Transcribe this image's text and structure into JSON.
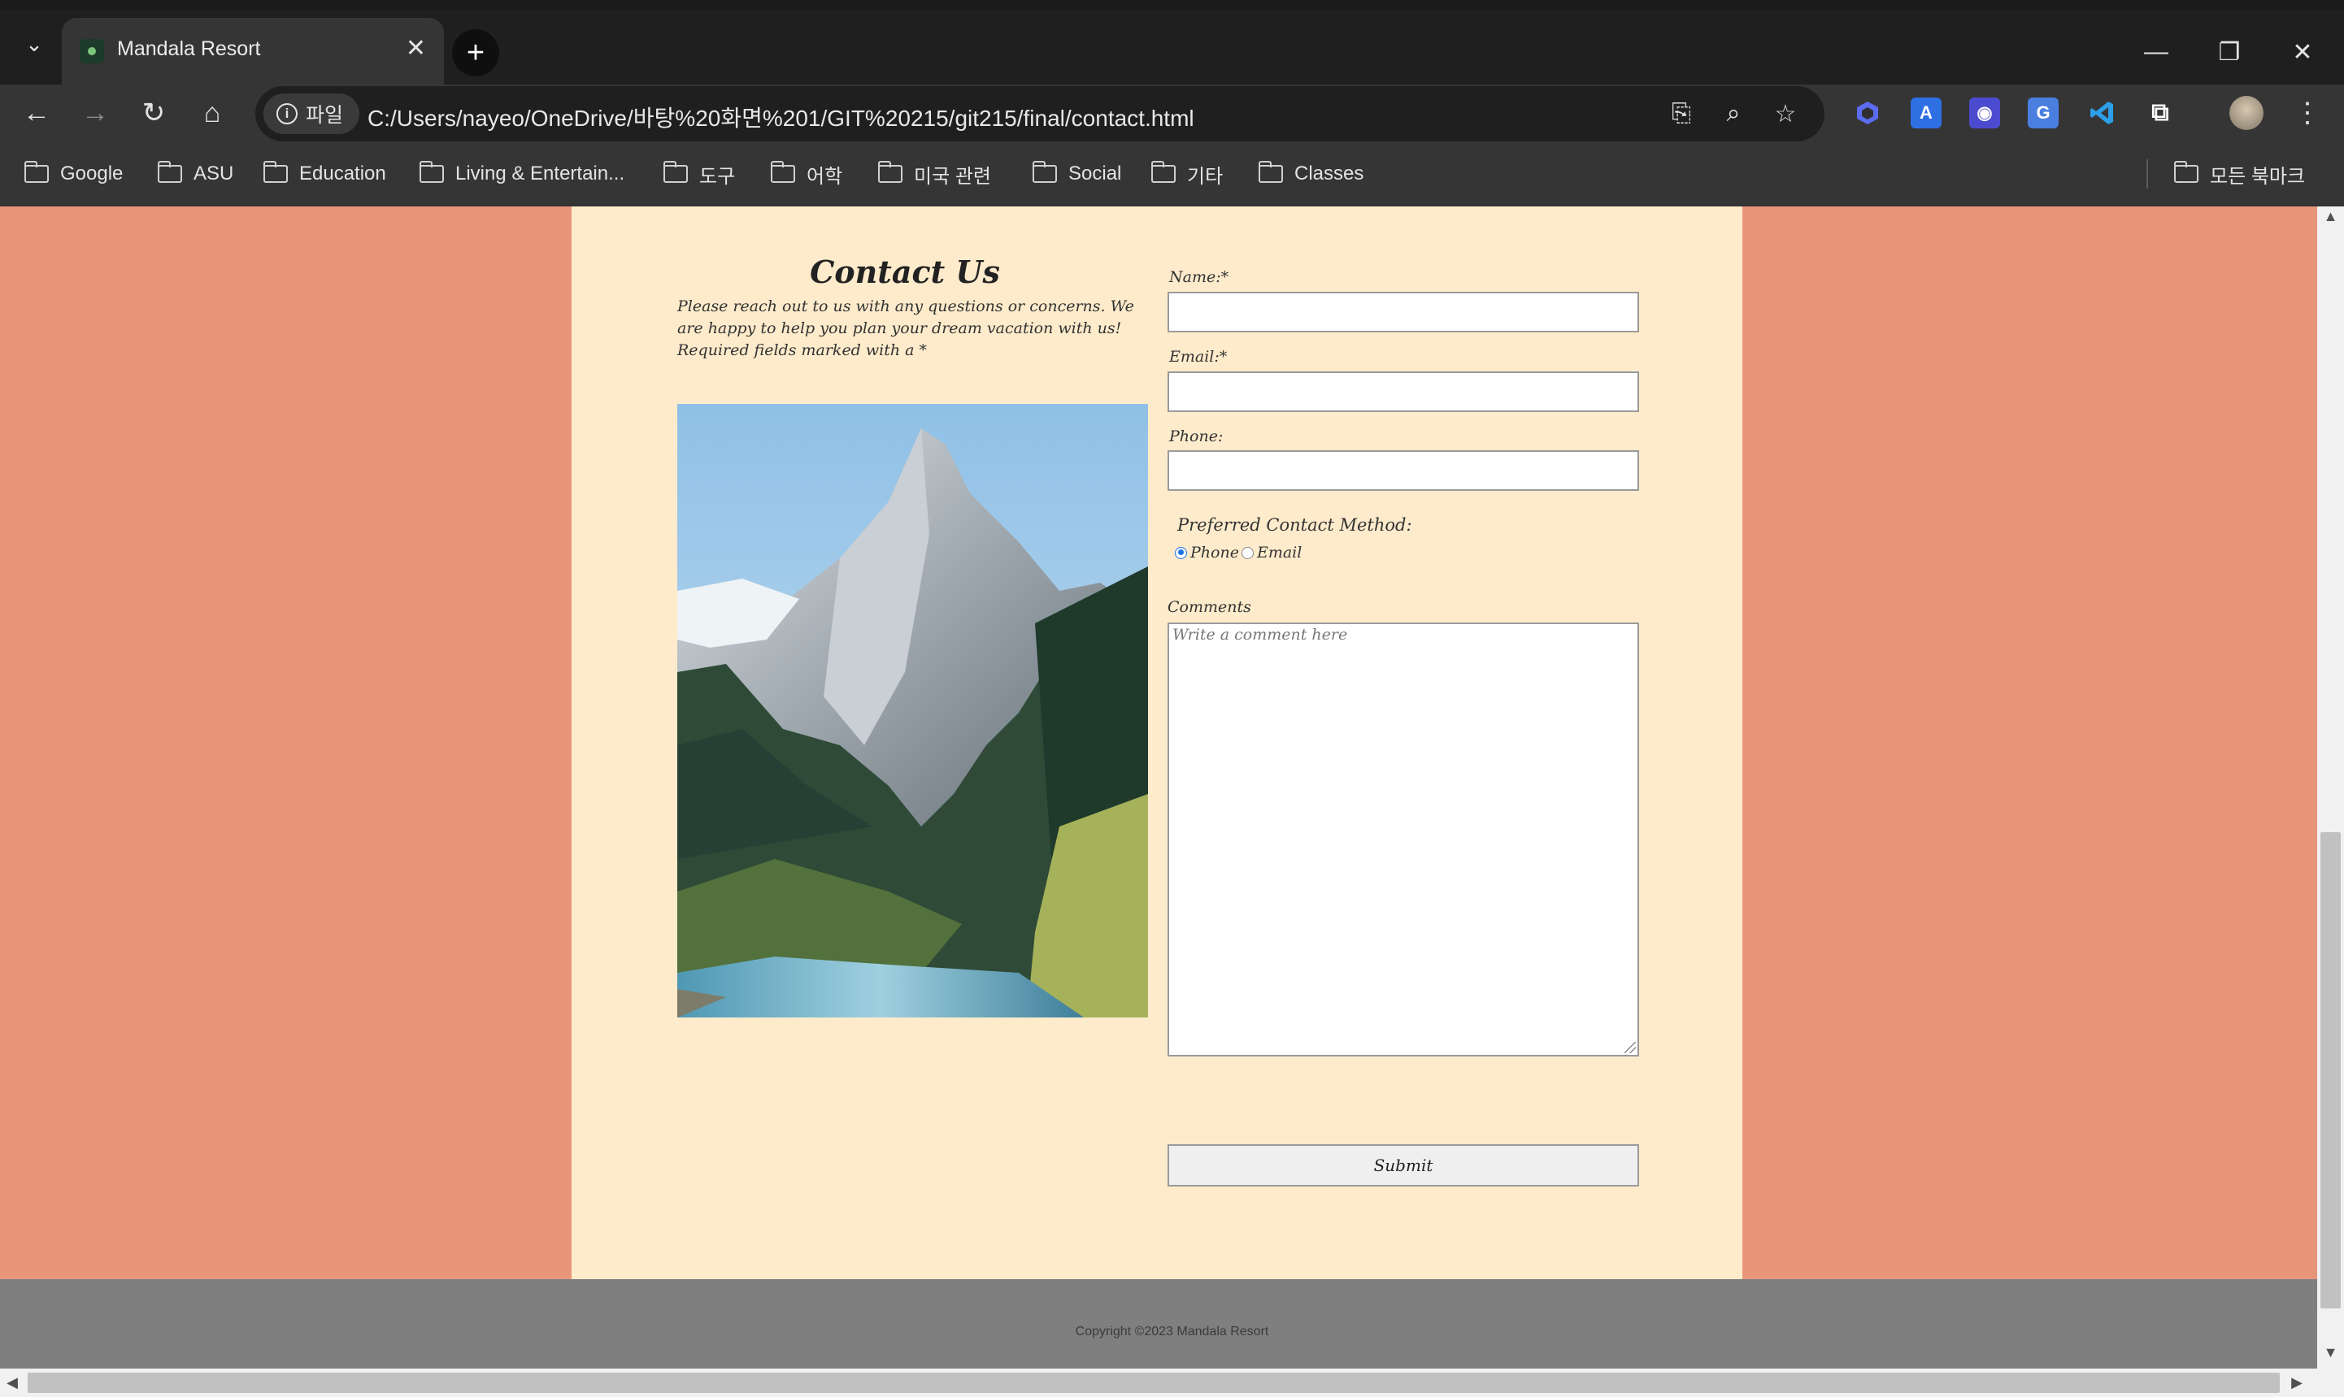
{
  "browser": {
    "tab_title": "Mandala Resort",
    "site_chip": "파일",
    "url": "C:/Users/nayeo/OneDrive/바탕%20화면%201/GIT%20215/git215/final/contact.html",
    "bookmarks": [
      "Google",
      "ASU",
      "Education",
      "Living & Entertain...",
      "도구",
      "어학",
      "미국 관련",
      "Social",
      "기타",
      "Classes"
    ],
    "all_bookmarks": "모든 북마크",
    "extension_letter": "A"
  },
  "page": {
    "heading": "Contact Us",
    "intro": "Please reach out to us with any questions or concerns. We are happy to help you plan your dream vacation with us! Required fields marked with a *",
    "form": {
      "name_label": "Name:*",
      "email_label": "Email:*",
      "phone_label": "Phone:",
      "preferred_label": "Preferred Contact Method:",
      "radio_phone": "Phone",
      "radio_email": "Email",
      "selected_method": "Phone",
      "comments_label": "Comments",
      "comments_placeholder": "Write a comment here",
      "submit_label": "Submit"
    },
    "footer": "Copyright ©2023 Mandala Resort"
  },
  "colors": {
    "background": "#e8967a",
    "content": "#feebcb",
    "footer": "#7f7f7f"
  }
}
